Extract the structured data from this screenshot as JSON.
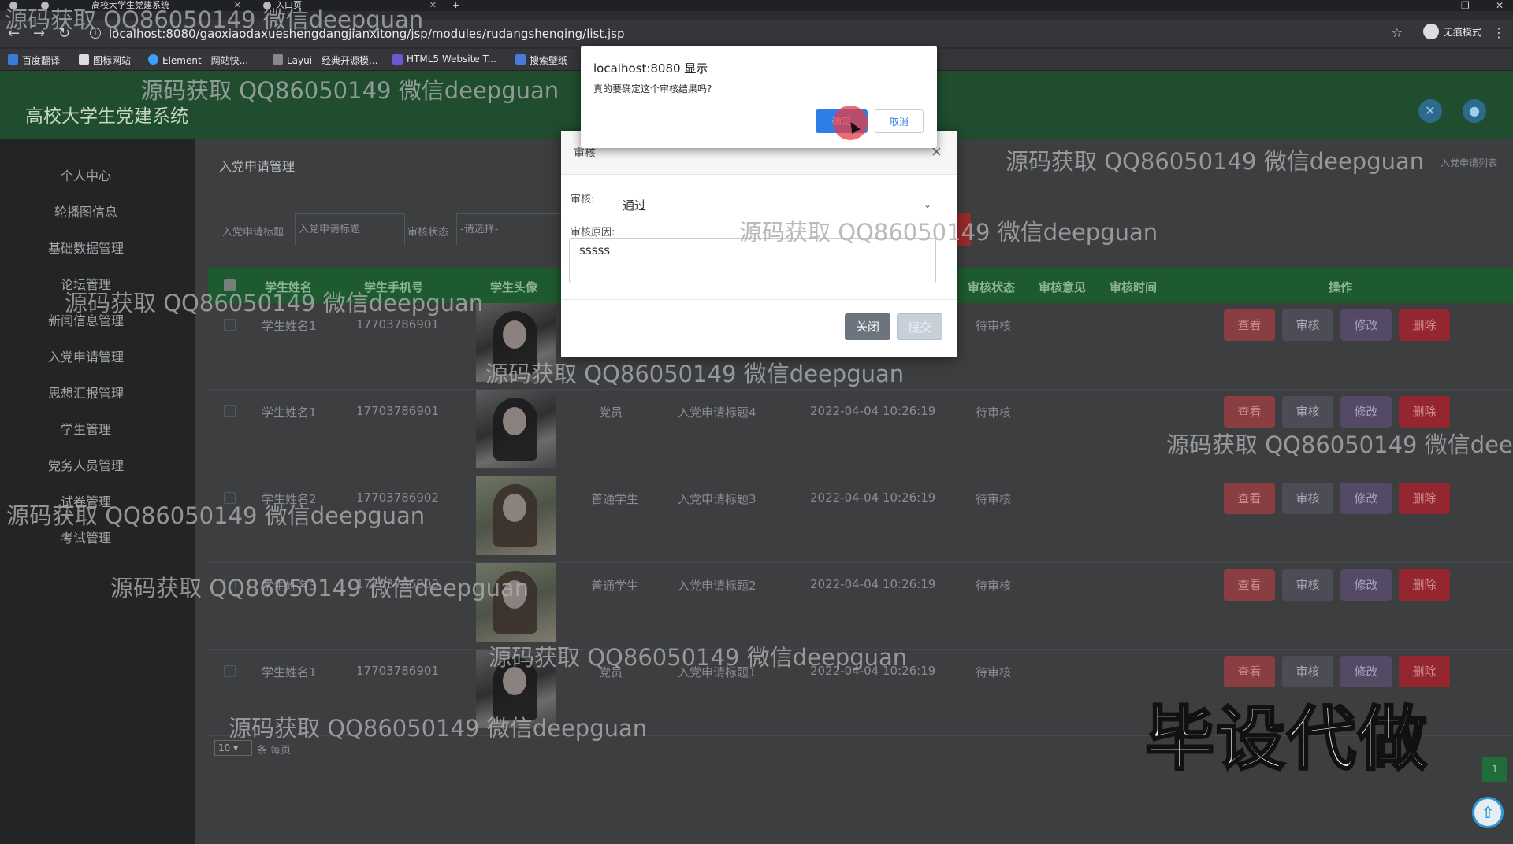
{
  "browser": {
    "tabs": [
      {
        "title": "高校大学生党建系统"
      },
      {
        "title": "入口页"
      }
    ],
    "new_tab": "+",
    "url": "localhost:8080/gaoxiaodaxueshengdangjianxitong/jsp/modules/rudangshenqing/list.jsp",
    "bookmarks": [
      "百度翻译",
      "图标网站",
      "Element - 网站快...",
      "Layui - 经典开源模...",
      "HTML5 Website T...",
      "搜索壁纸"
    ],
    "incognito": "无痕模式",
    "window_controls": [
      "–",
      "❐",
      "✕"
    ]
  },
  "app": {
    "title": "高校大学生党建系统"
  },
  "sidebar": {
    "items": [
      "个人中心",
      "轮播图信息",
      "基础数据管理",
      "论坛管理",
      "新闻信息管理",
      "入党申请管理",
      "思想汇报管理",
      "学生管理",
      "党务人员管理",
      "试卷管理",
      "考试管理"
    ]
  },
  "page": {
    "title": "入党申请管理",
    "breadcrumb": "入党申请列表"
  },
  "search": {
    "title_label": "入党申请标题",
    "title_placeholder": "入党申请标题",
    "status_label": "审核状态",
    "status_value": "-请选择-"
  },
  "table": {
    "headers": [
      "学生姓名",
      "学生手机号",
      "学生头像",
      "审核状态",
      "审核意见",
      "审核时间",
      "操作"
    ],
    "rows": [
      {
        "name": "学生姓名1",
        "phone": "17703786901",
        "role": "",
        "title": "",
        "time": "",
        "status": "待审核"
      },
      {
        "name": "学生姓名1",
        "phone": "17703786901",
        "role": "党员",
        "title": "入党申请标题4",
        "time": "2022-04-04 10:26:19",
        "status": "待审核"
      },
      {
        "name": "学生姓名2",
        "phone": "17703786902",
        "role": "普通学生",
        "title": "入党申请标题3",
        "time": "2022-04-04 10:26:19",
        "status": "待审核"
      },
      {
        "name": "学生姓名3",
        "phone": "17703786903",
        "role": "普通学生",
        "title": "入党申请标题2",
        "time": "2022-04-04 10:26:19",
        "status": "待审核"
      },
      {
        "name": "学生姓名1",
        "phone": "17703786901",
        "role": "党员",
        "title": "入党申请标题1",
        "time": "2022-04-04 10:26:19",
        "status": "待审核"
      }
    ],
    "actions": {
      "view": "查看",
      "audit": "审核",
      "edit": "修改",
      "delete": "删除"
    }
  },
  "pagination": {
    "page_size": "10",
    "page_size_label": "条 每页",
    "current_page": "1"
  },
  "audit_modal": {
    "title": "审核",
    "close_icon": "×",
    "status_label": "审核:",
    "status_value": "通过",
    "reason_label": "审核原因:",
    "reason_value": "sssss",
    "close_button": "关闭",
    "submit_button": "提交"
  },
  "confirm_dialog": {
    "title": "localhost:8080 显示",
    "message": "真的要确定这个审核结果吗?",
    "ok": "确定",
    "cancel": "取消"
  },
  "watermarks": {
    "text": "源码获取 QQ86050149 微信deepguan",
    "partial": "源码获取 QQ86050149 微信dee",
    "stamp": "毕设代做"
  },
  "colors": {
    "header": "#1f4d2d",
    "table_header": "#1e5a30",
    "confirm_primary": "#2f7ee6",
    "delete": "#93262e"
  }
}
